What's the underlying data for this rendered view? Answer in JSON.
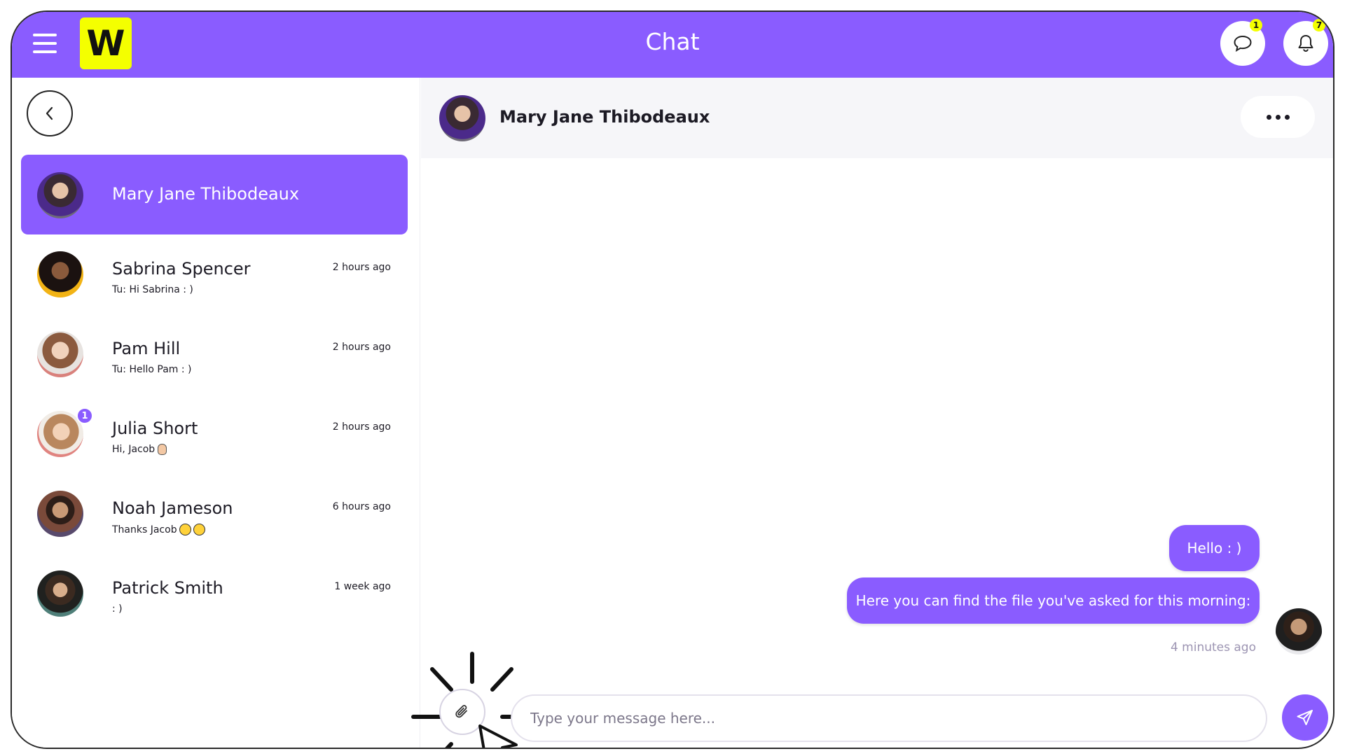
{
  "app": {
    "title": "Chat",
    "logo_letter": "W",
    "messages_badge": "1",
    "notifications_badge": "7",
    "accent_color": "#8a5cff",
    "logo_color": "#f4ff00"
  },
  "sidebar": {
    "conversations": [
      {
        "name": "Mary Jane Thibodeaux",
        "preview": "",
        "time": "",
        "active": true
      },
      {
        "name": "Sabrina Spencer",
        "preview": "Tu: Hi Sabrina : )",
        "time": "2 hours ago"
      },
      {
        "name": "Pam Hill",
        "preview": "Tu: Hello Pam : )",
        "time": "2 hours ago"
      },
      {
        "name": "Julia Short",
        "preview": "Hi, Jacob",
        "time": "2 hours ago",
        "unread": "1"
      },
      {
        "name": "Noah Jameson",
        "preview": "Thanks Jacob",
        "time": "6 hours ago"
      },
      {
        "name": "Patrick Smith",
        "preview": ": )",
        "time": "1 week ago"
      }
    ]
  },
  "chat": {
    "contact_name": "Mary Jane Thibodeaux",
    "messages": [
      {
        "text": "Hello : )"
      },
      {
        "text": "Here you can find the file you've asked for this morning:"
      }
    ],
    "last_message_time": "4 minutes ago",
    "input_placeholder": "Type your message here..."
  }
}
